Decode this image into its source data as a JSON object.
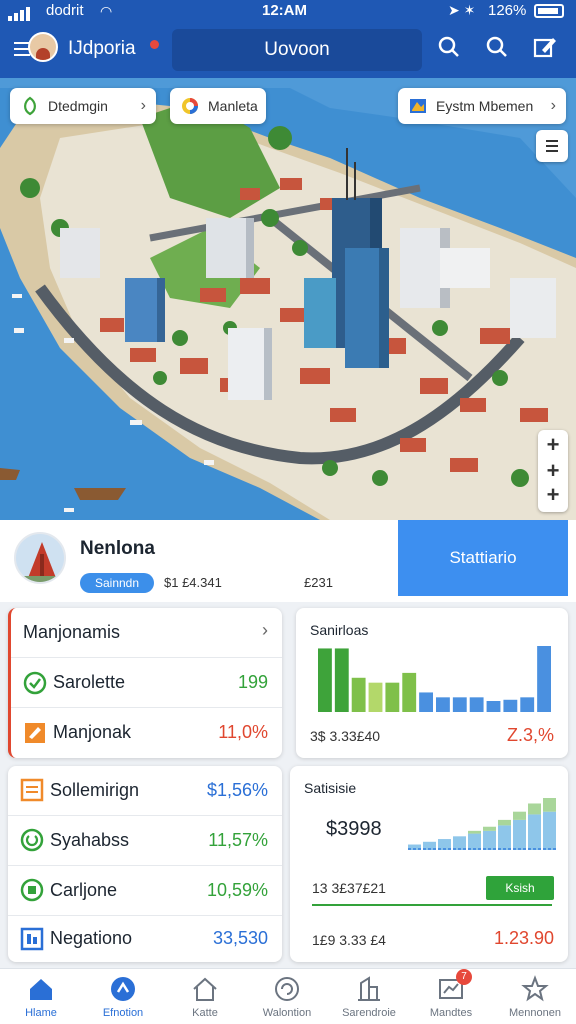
{
  "status_bar": {
    "carrier": "dodrit",
    "time": "12:AM",
    "battery": "126%"
  },
  "header": {
    "app_title": "IJdporia",
    "location": "Uovoon"
  },
  "map": {
    "chips": [
      {
        "label": "Dtedmgin",
        "icon": "leaf-icon"
      },
      {
        "label": "Manleta",
        "icon": "color-wheel-icon"
      },
      {
        "label": "Eystm Mbemen",
        "icon": "map-book-icon"
      }
    ],
    "zoom_in": "+",
    "zoom_in_2": "+",
    "zoom_out": "+"
  },
  "summary": {
    "name": "Nenlona",
    "pill": "Sainndn",
    "value_1": "$1 £4.341",
    "value_2": "£231",
    "button": "Stattiario"
  },
  "card_left_top": {
    "header": "Manjonamis",
    "rows": [
      {
        "label": "Sarolette",
        "value": "199",
        "tone": "green",
        "icon": "check-circle-icon"
      },
      {
        "label": "Manjonak",
        "value": "11,0%",
        "tone": "red",
        "icon": "pencil-square-icon"
      }
    ]
  },
  "card_left_bottom": {
    "rows": [
      {
        "label": "Sollemirign",
        "value": "$1,56%",
        "tone": "blue",
        "icon": "list-square-icon"
      },
      {
        "label": "Syahabss",
        "value": "11,57%",
        "tone": "green",
        "icon": "power-circle-icon"
      },
      {
        "label": "Carljone",
        "value": "10,59%",
        "tone": "green",
        "icon": "leaf-square-icon"
      },
      {
        "label": "Negationo",
        "value": "33,530",
        "tone": "blue",
        "icon": "grid-square-icon"
      }
    ]
  },
  "chart_top": {
    "title": "Sanirloas",
    "footer_left": "3$ 3.33£40",
    "footer_right": "Z.3,%"
  },
  "chart_bottom": {
    "title": "Satisisie",
    "big_value": "$3998",
    "footer_left": "13 3£37£21",
    "chip": "Ksish",
    "footer_left_2": "1£9 3.33 £4",
    "footer_right": "1.23.90"
  },
  "chart_data": [
    {
      "type": "bar",
      "title": "Sanirloas",
      "categories": [
        "1",
        "2",
        "3",
        "4",
        "5",
        "6",
        "7",
        "8",
        "9",
        "10",
        "11",
        "12",
        "13",
        "14"
      ],
      "values": [
        52,
        52,
        28,
        24,
        24,
        32,
        16,
        12,
        12,
        12,
        9,
        10,
        12,
        54
      ],
      "colors": [
        "#3ea33a",
        "#3ea33a",
        "#7fc04a",
        "#b3d86a",
        "#7fc04a",
        "#7fc04a",
        "#4a90e0",
        "#4a90e0",
        "#4a90e0",
        "#4a90e0",
        "#4a90e0",
        "#4a90e0",
        "#4a90e0",
        "#4a90e0"
      ]
    },
    {
      "type": "bar",
      "title": "Satisisie",
      "categories": [
        "1",
        "2",
        "3",
        "4",
        "5",
        "6",
        "7",
        "8",
        "9",
        "10"
      ],
      "values": [
        4,
        6,
        8,
        10,
        12,
        14,
        18,
        22,
        26,
        28
      ],
      "overlay": [
        0,
        0,
        0,
        0,
        2,
        3,
        4,
        6,
        8,
        10
      ]
    }
  ],
  "tabbar": {
    "tabs": [
      {
        "label": "Hlame",
        "icon": "home-icon",
        "active": true
      },
      {
        "label": "Efnotion",
        "icon": "compass-icon",
        "active": true
      },
      {
        "label": "Katte",
        "icon": "house-outline-icon",
        "active": false
      },
      {
        "label": "Walontion",
        "icon": "refresh-icon",
        "active": false
      },
      {
        "label": "Sarendroie",
        "icon": "building-icon",
        "active": false
      },
      {
        "label": "Mandtes",
        "icon": "chart-board-icon",
        "active": false,
        "badge": "7"
      },
      {
        "label": "Mennonen",
        "icon": "star-outline-icon",
        "active": false
      }
    ]
  },
  "colors": {
    "primary": "#1f58b4",
    "accent": "#3d8ff0",
    "positive": "#33a23a",
    "negative": "#e0472f"
  }
}
